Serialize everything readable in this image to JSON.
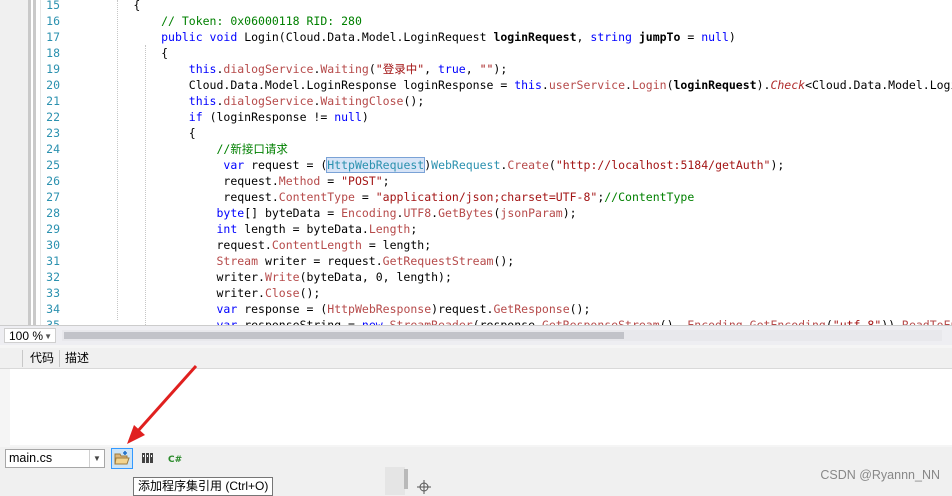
{
  "editor": {
    "line_numbers": [
      "15",
      "16",
      "17",
      "18",
      "19",
      "20",
      "21",
      "22",
      "23",
      "24",
      "25",
      "26",
      "27",
      "28",
      "29",
      "30",
      "31",
      "32",
      "33",
      "34",
      "35"
    ],
    "lines": [
      [
        {
          "t": "        {"
        }
      ],
      [
        {
          "t": "            "
        },
        {
          "c": "cm",
          "t": "// Token: 0x06000118 RID: 280"
        }
      ],
      [
        {
          "t": "            "
        },
        {
          "c": "kw",
          "t": "public void "
        },
        {
          "t": "Login(Cloud.Data.Model.LoginRequest "
        },
        {
          "c": "bold",
          "t": "loginRequest"
        },
        {
          "t": ", "
        },
        {
          "c": "kw",
          "t": "string "
        },
        {
          "c": "bold",
          "t": "jumpTo"
        },
        {
          "t": " = "
        },
        {
          "c": "kw",
          "t": "null"
        },
        {
          "t": ")"
        }
      ],
      [
        {
          "t": "            {"
        }
      ],
      [
        {
          "t": "                "
        },
        {
          "c": "kw",
          "t": "this"
        },
        {
          "t": "."
        },
        {
          "c": "mem",
          "t": "dialogService"
        },
        {
          "t": "."
        },
        {
          "c": "mem",
          "t": "Waiting"
        },
        {
          "t": "("
        },
        {
          "c": "str",
          "t": "\"登录中\""
        },
        {
          "t": ", "
        },
        {
          "c": "kw",
          "t": "true"
        },
        {
          "t": ", "
        },
        {
          "c": "str",
          "t": "\"\""
        },
        {
          "t": ");"
        }
      ],
      [
        {
          "t": "                Cloud.Data.Model.LoginResponse loginResponse = "
        },
        {
          "c": "kw",
          "t": "this"
        },
        {
          "t": "."
        },
        {
          "c": "mem",
          "t": "userService"
        },
        {
          "t": "."
        },
        {
          "c": "mem",
          "t": "Login"
        },
        {
          "t": "("
        },
        {
          "c": "bold",
          "t": "loginRequest"
        },
        {
          "t": ")."
        },
        {
          "c": "ext",
          "t": "Check"
        },
        {
          "t": "<Cloud.Data.Model.LoginResponse>();"
        }
      ],
      [
        {
          "t": "                "
        },
        {
          "c": "kw",
          "t": "this"
        },
        {
          "t": "."
        },
        {
          "c": "mem",
          "t": "dialogService"
        },
        {
          "t": "."
        },
        {
          "c": "mem",
          "t": "WaitingClose"
        },
        {
          "t": "();"
        }
      ],
      [
        {
          "t": "                "
        },
        {
          "c": "kw",
          "t": "if "
        },
        {
          "t": "(loginResponse != "
        },
        {
          "c": "kw",
          "t": "null"
        },
        {
          "t": ")"
        }
      ],
      [
        {
          "t": "                {"
        }
      ],
      [
        {
          "t": "                    "
        },
        {
          "c": "cm",
          "t": "//新接口请求"
        }
      ],
      [
        {
          "t": "                     "
        },
        {
          "c": "kw",
          "t": "var "
        },
        {
          "t": "request = ("
        },
        {
          "c": "ty sel",
          "t": "HttpWebRequest"
        },
        {
          "t": ")"
        },
        {
          "c": "ty",
          "t": "WebRequest"
        },
        {
          "t": "."
        },
        {
          "c": "mem",
          "t": "Create"
        },
        {
          "t": "("
        },
        {
          "c": "str",
          "t": "\"http://localhost:5184/getAuth\""
        },
        {
          "t": ");"
        }
      ],
      [
        {
          "t": "                     request."
        },
        {
          "c": "mem",
          "t": "Method"
        },
        {
          "t": " = "
        },
        {
          "c": "str",
          "t": "\"POST\""
        },
        {
          "t": ";"
        }
      ],
      [
        {
          "t": "                     request."
        },
        {
          "c": "mem",
          "t": "ContentType"
        },
        {
          "t": " = "
        },
        {
          "c": "str",
          "t": "\"application/json;charset=UTF-8\""
        },
        {
          "t": ";"
        },
        {
          "c": "cm",
          "t": "//ContentType"
        }
      ],
      [
        {
          "t": "                    "
        },
        {
          "c": "kw",
          "t": "byte"
        },
        {
          "t": "[] byteData = "
        },
        {
          "c": "mem",
          "t": "Encoding"
        },
        {
          "t": "."
        },
        {
          "c": "mem",
          "t": "UTF8"
        },
        {
          "t": "."
        },
        {
          "c": "mem",
          "t": "GetBytes"
        },
        {
          "t": "("
        },
        {
          "c": "mem",
          "t": "jsonParam"
        },
        {
          "t": ");"
        }
      ],
      [
        {
          "t": "                    "
        },
        {
          "c": "kw",
          "t": "int "
        },
        {
          "t": "length = byteData."
        },
        {
          "c": "mem",
          "t": "Length"
        },
        {
          "t": ";"
        }
      ],
      [
        {
          "t": "                    request."
        },
        {
          "c": "mem",
          "t": "ContentLength"
        },
        {
          "t": " = length;"
        }
      ],
      [
        {
          "t": "                    "
        },
        {
          "c": "mem",
          "t": "Stream "
        },
        {
          "t": "writer = request."
        },
        {
          "c": "mem",
          "t": "GetRequestStream"
        },
        {
          "t": "();"
        }
      ],
      [
        {
          "t": "                    writer."
        },
        {
          "c": "mem",
          "t": "Write"
        },
        {
          "t": "(byteData, 0, length);"
        }
      ],
      [
        {
          "t": "                    writer."
        },
        {
          "c": "mem",
          "t": "Close"
        },
        {
          "t": "();"
        }
      ],
      [
        {
          "t": "                    "
        },
        {
          "c": "kw",
          "t": "var "
        },
        {
          "t": "response = ("
        },
        {
          "c": "mem",
          "t": "HttpWebResponse"
        },
        {
          "t": ")request."
        },
        {
          "c": "mem",
          "t": "GetResponse"
        },
        {
          "t": "();"
        }
      ],
      [
        {
          "t": "                    "
        },
        {
          "c": "kw",
          "t": "var "
        },
        {
          "t": "responseString = "
        },
        {
          "c": "kw",
          "t": "new "
        },
        {
          "c": "mem",
          "t": "StreamReader"
        },
        {
          "t": "(response."
        },
        {
          "c": "mem",
          "t": "GetResponseStream"
        },
        {
          "t": "(), "
        },
        {
          "c": "mem",
          "t": "Encoding"
        },
        {
          "t": "."
        },
        {
          "c": "mem",
          "t": "GetEncoding"
        },
        {
          "t": "("
        },
        {
          "c": "str",
          "t": "\"utf-8\""
        },
        {
          "t": "))."
        },
        {
          "c": "mem",
          "t": "ReadToEnd"
        },
        {
          "t": "();"
        }
      ]
    ]
  },
  "zoom": {
    "value": "100 %"
  },
  "error_list": {
    "col_code": "代码",
    "col_desc": "描述"
  },
  "toolbar": {
    "file_select": "main.cs",
    "tooltip": "添加程序集引用 (Ctrl+O)",
    "csharp_label": "C#"
  },
  "watermark": "CSDN @Ryannn_NN",
  "colors": {
    "keyword": "#0000ff",
    "comment": "#008000",
    "string": "#a31515",
    "type": "#2b91af",
    "member": "#b64a4a",
    "arrow": "#e0201f"
  }
}
